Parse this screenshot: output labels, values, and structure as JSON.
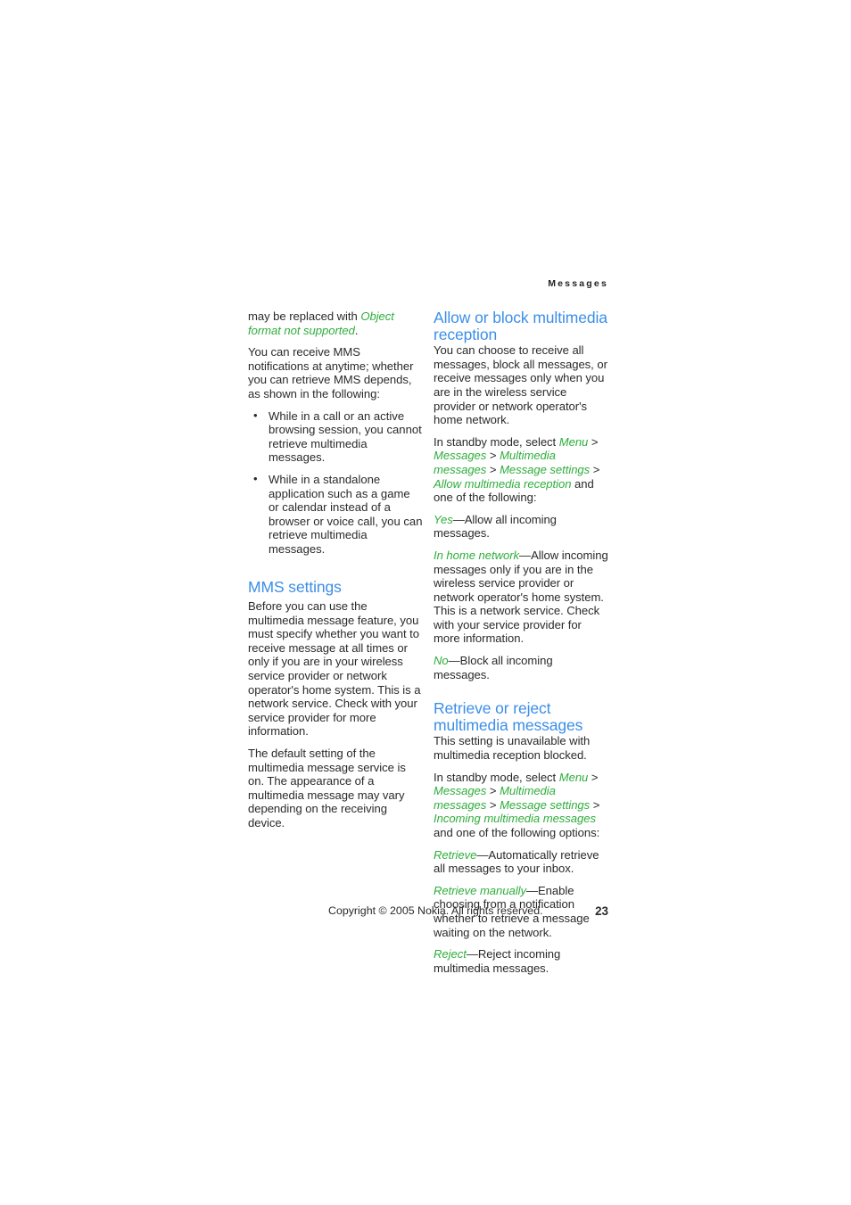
{
  "document": {
    "running_header": "Messages",
    "page_number": "23",
    "copyright": "Copyright © 2005 Nokia. All rights reserved."
  },
  "colors": {
    "heading_blue": "#3b8ee8",
    "keyword_green": "#2eae3b",
    "body_text": "#2a2a2a",
    "page_background": "#ffffff"
  },
  "left_column": {
    "para_1_a": "may be replaced with ",
    "para_1_kw": "Object format not supported",
    "para_1_b": ".",
    "para_2": "You can receive MMS notifications at anytime; whether you can retrieve MMS depends, as shown in the following:",
    "bullets": [
      "While in a call or an active browsing session, you cannot retrieve multimedia messages.",
      "While in a standalone application such as a game or calendar instead of a browser or voice call, you can retrieve multimedia messages."
    ],
    "heading_mms_settings": "MMS settings",
    "para_3": "Before you can use the multimedia message feature, you must specify whether you want to receive message at all times or only if you are in your wireless service provider or network operator's home system. This is a network service. Check with your service provider for more information.",
    "para_4": "The default setting of the multimedia message service is on. The appearance of a multimedia message may vary depending on the receiving device."
  },
  "right_column": {
    "heading_allow_block": "Allow or block multimedia reception",
    "para_1": "You can choose to receive all messages, block all messages, or receive messages only when you are in the wireless service provider or network operator's home network.",
    "path_1": {
      "lead": "In standby mode, select ",
      "menu": "Menu",
      "sep": " > ",
      "messages": "Messages",
      "multimedia_messages": "Multimedia messages",
      "message_settings": "Message settings",
      "target": "Allow multimedia reception",
      "tail": " and one of the following:"
    },
    "option_yes_kw": "Yes",
    "option_yes_text": "—Allow all incoming messages.",
    "option_home_kw": "In home network",
    "option_home_text": "—Allow incoming messages only if you are in the wireless service provider or network operator's home system. This is a network service. Check with your service provider for more information.",
    "option_no_kw": "No",
    "option_no_text": "—Block all incoming messages.",
    "heading_retrieve_reject": "Retrieve or reject multimedia messages",
    "para_2": "This setting is unavailable with multimedia reception blocked.",
    "path_2": {
      "lead": "In standby mode, select ",
      "menu": "Menu",
      "sep": " > ",
      "messages": "Messages",
      "multimedia_messages": "Multimedia messages",
      "message_settings": "Message settings",
      "target": "Incoming multimedia messages",
      "tail": " and one of the following options:"
    },
    "option_retrieve_kw": "Retrieve",
    "option_retrieve_text": "—Automatically retrieve all messages to your inbox.",
    "option_retrieve_manually_kw": "Retrieve manually",
    "option_retrieve_manually_text": "—Enable choosing from a notification whether to retrieve a message waiting on the network.",
    "option_reject_kw": "Reject",
    "option_reject_text": "—Reject incoming multimedia messages."
  }
}
